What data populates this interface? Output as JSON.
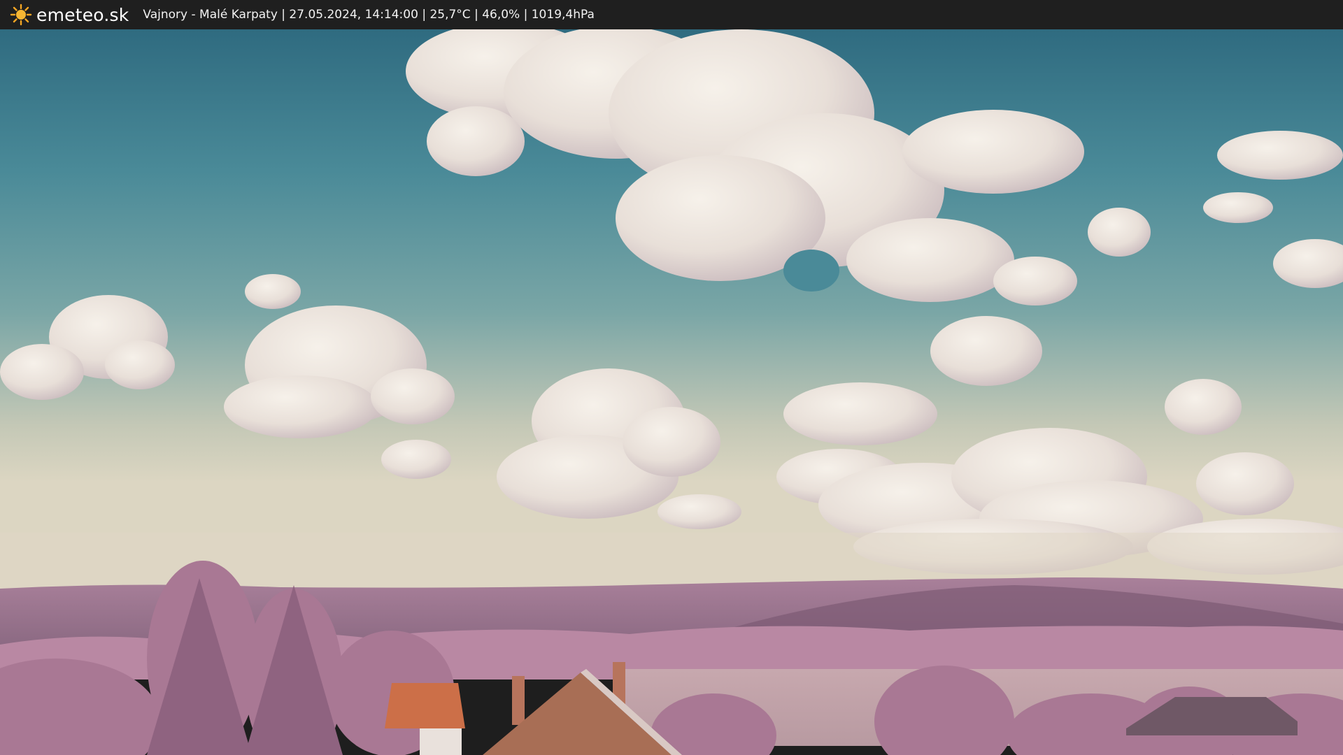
{
  "header": {
    "brand": "emeteo.sk",
    "info": "Vajnory - Malé Karpaty | 27.05.2024, 14:14:00 | 25,7°C | 46,0% | 1019,4hPa",
    "logo_icon": "sun-icon"
  },
  "colors": {
    "bar_background": "#1f1f1f",
    "sun": "#f5a623",
    "sky_top": "#3f7f91",
    "sky_horizon": "#d9d6c6",
    "foliage": "#b9869f",
    "roof": "#d07a56"
  }
}
